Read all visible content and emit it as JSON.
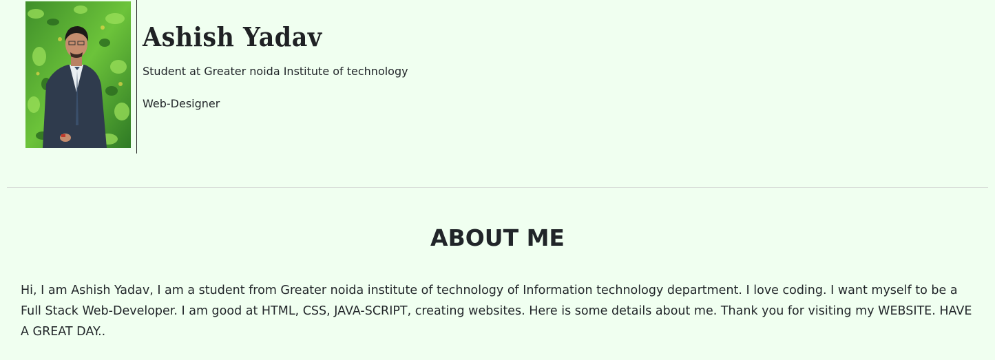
{
  "header": {
    "name": "Ashish Yadav",
    "subtitle": "Student at Greater noida Institute of technology",
    "role": "Web-Designer",
    "photo": "profile-photo of a man in a dark suit in front of a green plant wall"
  },
  "about": {
    "heading": "ABOUT ME",
    "text": "Hi, I am Ashish Yadav, I am a student from Greater noida institute of technology of Information technology department. I love coding. I want myself to be a Full Stack Web-Developer. I am good at HTML, CSS, JAVA-SCRIPT, creating websites. Here is some details about me. Thank you for visiting my WEBSITE. HAVE A GREAT DAY.."
  },
  "colors": {
    "background": "#f0fff0",
    "text": "#212529",
    "divider": "#222222",
    "rule": "#d8dcd8"
  }
}
